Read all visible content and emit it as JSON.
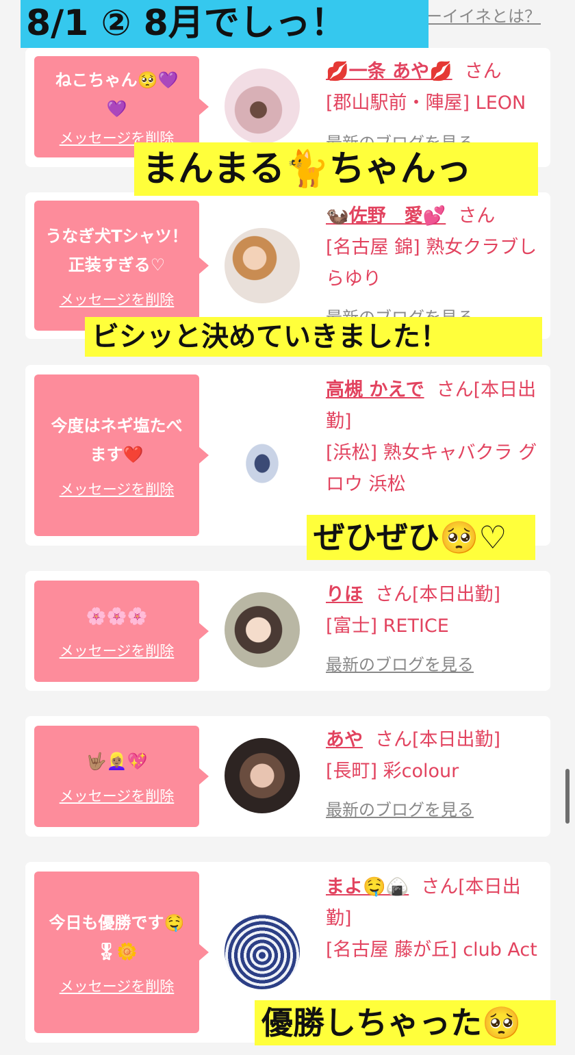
{
  "header": {
    "title": "8/1 ② 8月でしっ！",
    "link": "ーイイネとは？"
  },
  "cards": [
    {
      "message": "ねこちゃん🥺💜💜",
      "delete_label": "メッセージを削除",
      "name": "💋一条 あや💋",
      "san": "さん",
      "shop": "[郡山駅前・陣屋] LEON",
      "blog": "最新のブログを見る"
    },
    {
      "message": "うなぎ犬Tシャツ！正装すぎる♡",
      "delete_label": "メッセージを削除",
      "name": "🦦佐野　愛💕",
      "san": "さん",
      "shop": "[名古屋 錦] 熟女クラブしらゆり",
      "blog": "最新のブログを見る"
    },
    {
      "message": "今度はネギ塩たべます❤️",
      "delete_label": "メッセージを削除",
      "name": "高槻 かえで",
      "san": "さん[本日出勤]",
      "shop": "[浜松] 熟女キャバクラ グロウ 浜松",
      "blog": ""
    },
    {
      "message": "🌸🌸🌸",
      "delete_label": "メッセージを削除",
      "name": "りほ",
      "san": "さん[本日出勤]",
      "shop": "[富士] RETICE",
      "blog": "最新のブログを見る"
    },
    {
      "message": "🤟🏽👱🏽‍♀️💖",
      "delete_label": "メッセージを削除",
      "name": "あや",
      "san": "さん[本日出勤]",
      "shop": "[長町] 彩colour",
      "blog": "最新のブログを見る"
    },
    {
      "message": "今日も優勝です🤤🎖🌼",
      "delete_label": "メッセージを削除",
      "name": "まよ🤤🍙",
      "san": "さん[本日出勤]",
      "shop": "[名古屋 藤が丘] club Act",
      "blog": ""
    }
  ],
  "captions": {
    "c1": "まんまる🐈ちゃんっ",
    "c2": "ビシッと決めていきました！",
    "c3": "ぜひぜひ🥺♡",
    "c4": "優勝しちゃった🥺"
  },
  "colors": {
    "bubble": "#fd8c9b",
    "name": "#e2435f",
    "caption_bg": "#ffff3b",
    "title_bg": "#35c8ee"
  }
}
